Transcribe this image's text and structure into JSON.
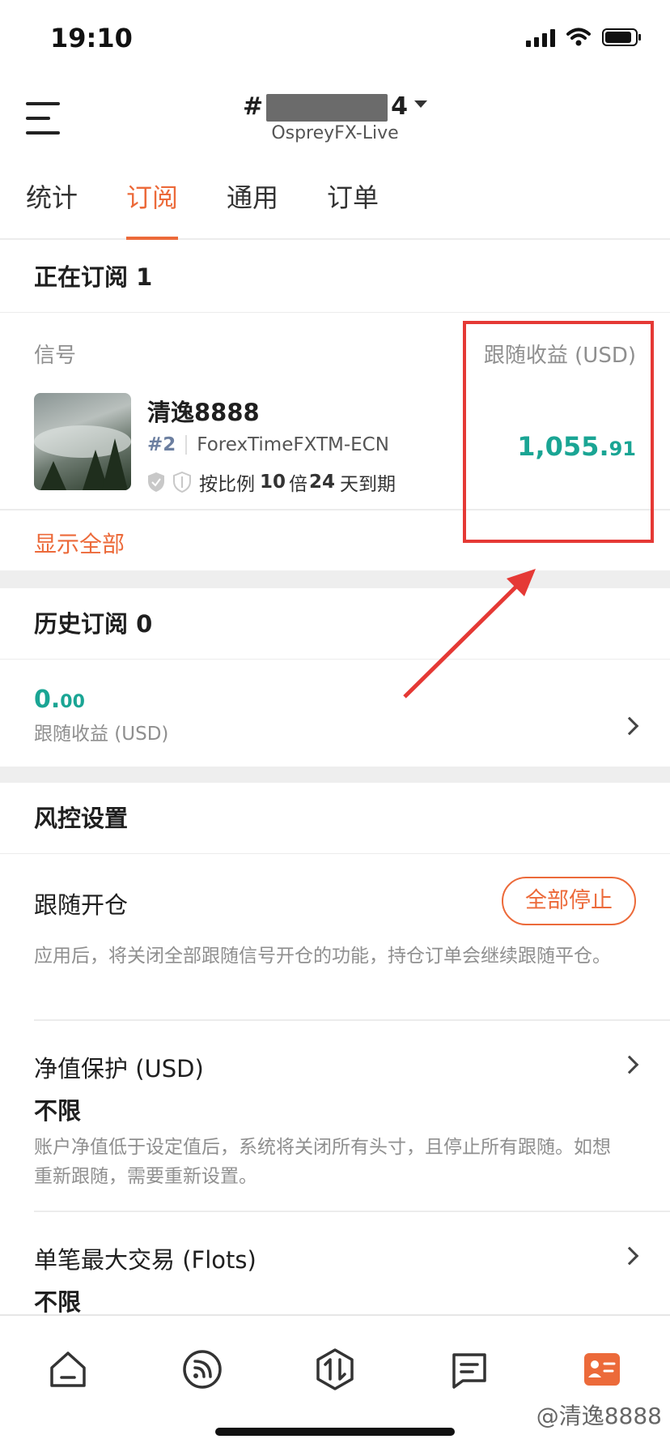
{
  "status_bar": {
    "time": "19:10"
  },
  "header": {
    "account_number_prefix": "#",
    "account_number_suffix": "4",
    "server": "OspreyFX-Live"
  },
  "tabs": [
    {
      "label": "统计",
      "active": false
    },
    {
      "label": "订阅",
      "active": true
    },
    {
      "label": "通用",
      "active": false
    },
    {
      "label": "订单",
      "active": false
    }
  ],
  "current_subscriptions": {
    "title": "正在订阅 1",
    "col_signal": "信号",
    "col_profit": "跟随收益 (USD)",
    "item": {
      "name": "清逸8888",
      "rank": "#2",
      "broker": "ForexTimeFXTM-ECN",
      "terms_prefix": "按比例",
      "ratio": "10",
      "ratio_unit": "倍",
      "days": "24",
      "days_suffix": "天到期",
      "profit_int": "1,055.",
      "profit_dec": "91"
    },
    "show_all": "显示全部"
  },
  "history_subscriptions": {
    "title": "历史订阅 0",
    "profit_int": "0.",
    "profit_dec": "00",
    "profit_label": "跟随收益 (USD)"
  },
  "risk_settings": {
    "title": "风控设置",
    "follow_open": {
      "title": "跟随开仓",
      "button": "全部停止",
      "desc": "应用后，将关闭全部跟随信号开仓的功能，持仓订单会继续跟随平仓。"
    },
    "equity_protection": {
      "title": "净值保护 (USD)",
      "value": "不限",
      "desc": "账户净值低于设定值后，系统将关闭所有头寸，且停止所有跟随。如想重新跟随，需要重新设置。"
    },
    "max_trade": {
      "title": "单笔最大交易 (Flots)",
      "value": "不限"
    }
  },
  "bottom_nav": [
    "home-icon",
    "feed-icon",
    "trade-icon",
    "messages-icon",
    "profile-icon"
  ],
  "watermark": "@清逸8888",
  "colors": {
    "accent": "#ec6a3a",
    "profit": "#1aa594",
    "annotation": "#e53935"
  }
}
